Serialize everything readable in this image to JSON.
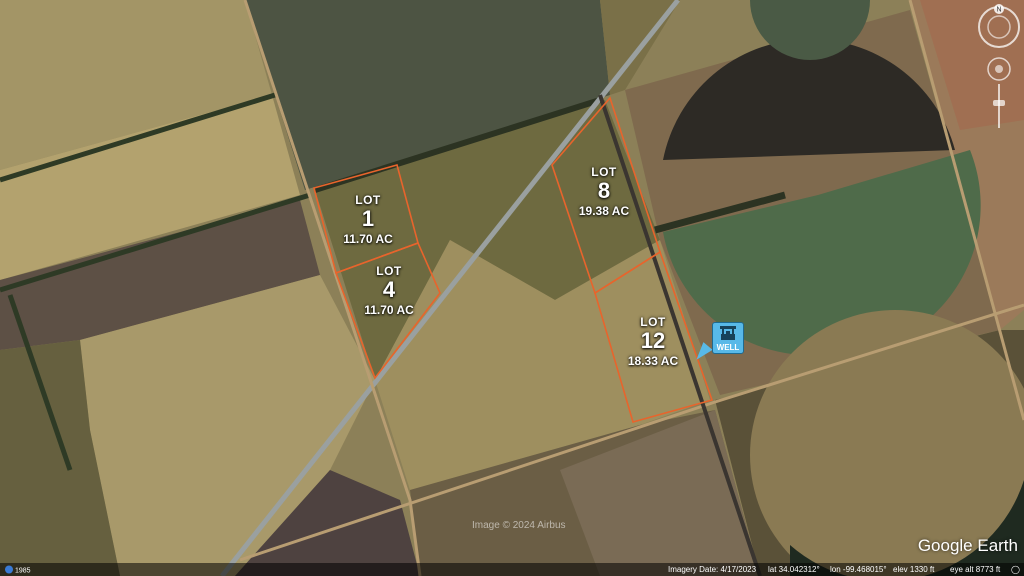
{
  "lots": [
    {
      "word": "LOT",
      "number": "1",
      "area": "11.70 AC"
    },
    {
      "word": "LOT",
      "number": "4",
      "area": "11.70 AC"
    },
    {
      "word": "LOT",
      "number": "8",
      "area": "19.38 AC"
    },
    {
      "word": "LOT",
      "number": "12",
      "area": "18.33 AC"
    }
  ],
  "well": {
    "label": "WELL",
    "color": "#58b9e8"
  },
  "boundary_color": "#e8642c",
  "watermark": "Image © 2024 Airbus",
  "brand": "Google Earth",
  "status": {
    "year": "1985",
    "imagery_date": "Imagery Date: 4/17/2023",
    "lat": "lat  34.042312°",
    "lon": "lon  -99.468015°",
    "elev": "elev  1330 ft",
    "eye_alt": "eye alt  8773 ft"
  },
  "compass_label": "N"
}
